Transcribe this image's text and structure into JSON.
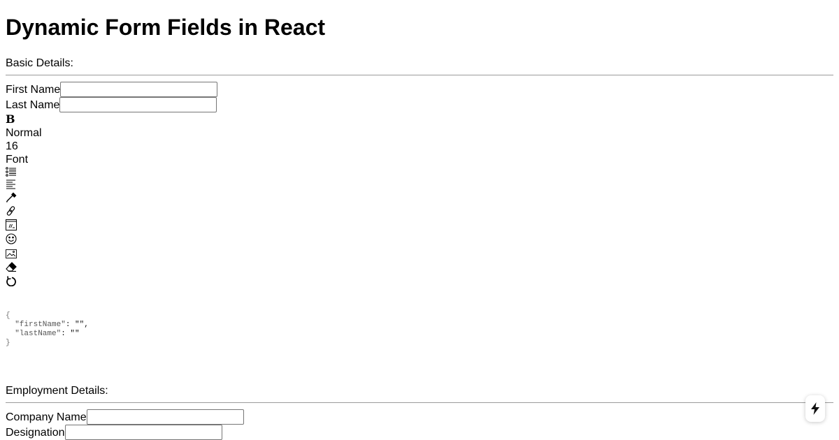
{
  "page": {
    "title": "Dynamic Form Fields in React"
  },
  "basic_details": {
    "heading": "Basic Details:",
    "first_name_label": "First Name",
    "first_name_value": "",
    "last_name_label": "Last Name",
    "last_name_value": ""
  },
  "toolbar": {
    "bold_label": "B",
    "block_type": "Normal",
    "font_size": "16",
    "font_family": "Font",
    "icons": [
      "unordered-list-icon",
      "text-align-icon",
      "color-picker-icon",
      "link-icon",
      "embed-icon",
      "emoji-icon",
      "image-icon",
      "eraser-icon",
      "undo-icon"
    ]
  },
  "json_output": {
    "open": "{",
    "line1_key": "\"firstName\"",
    "line1_rest": ": \"\",",
    "line2_key": "\"lastName\"",
    "line2_rest": ": \"\"",
    "close": "}"
  },
  "employment_details": {
    "heading": "Employment Details:",
    "company_label": "Company Name",
    "company_value": "",
    "designation_label": "Designation",
    "designation_value": ""
  },
  "floating_action": {
    "icon": "lightning-icon"
  }
}
